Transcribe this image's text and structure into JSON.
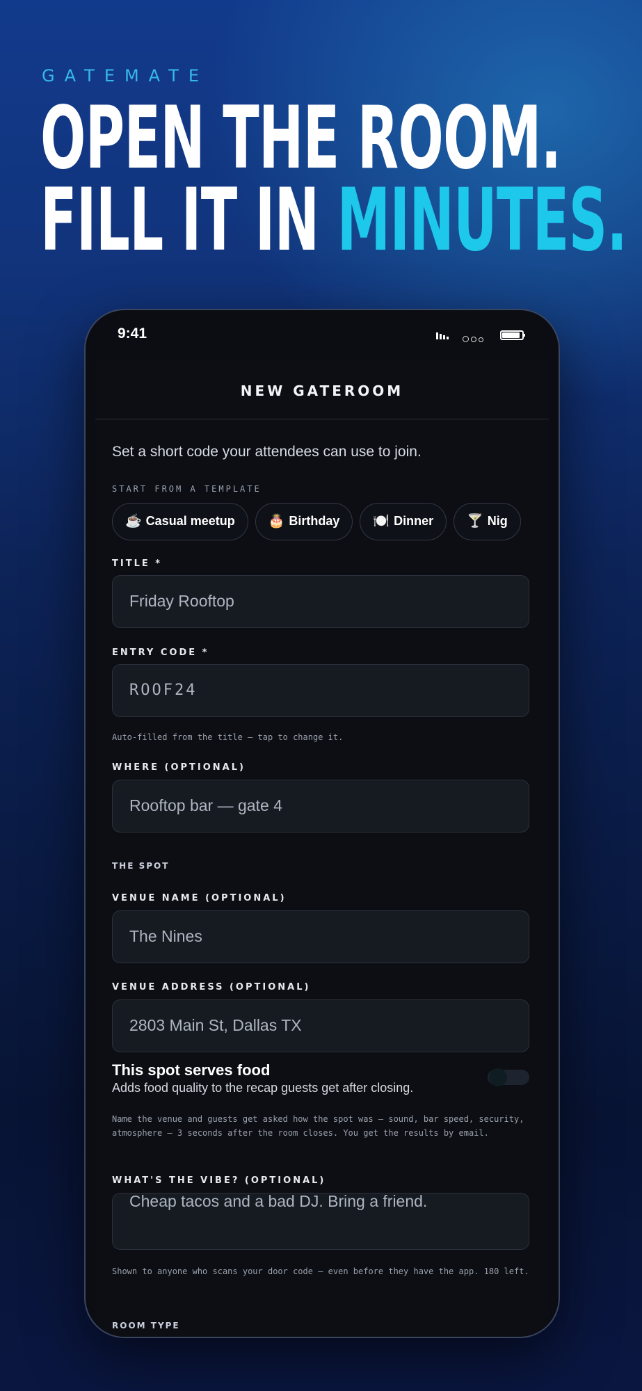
{
  "brand": "GATEMATE",
  "headline": {
    "line1": "OPEN THE ROOM.",
    "line2_prefix": "FILL IT IN ",
    "line2_accent": "MINUTES."
  },
  "status_bar": {
    "time": "9:41"
  },
  "nav": {
    "title": "NEW GATEROOM"
  },
  "form": {
    "lead": "Set a short code your attendees can use to join.",
    "template_heading": "START FROM A TEMPLATE",
    "templates": [
      {
        "icon": "☕",
        "label": "Casual meetup"
      },
      {
        "icon": "🎂",
        "label": "Birthday"
      },
      {
        "icon": "🍽️",
        "label": "Dinner"
      },
      {
        "icon": "🍸",
        "label": "Nig"
      }
    ],
    "title": {
      "label": "TITLE *",
      "value": "Friday Rooftop"
    },
    "entry_code": {
      "label": "ENTRY CODE *",
      "value": "ROOF24",
      "hint": "Auto-filled from the title — tap to change it."
    },
    "where": {
      "label": "WHERE (OPTIONAL)",
      "value": "Rooftop bar — gate 4"
    },
    "spot_heading": "THE SPOT",
    "venue_name": {
      "label": "VENUE NAME (OPTIONAL)",
      "value": "The Nines"
    },
    "venue_address": {
      "label": "VENUE ADDRESS (OPTIONAL)",
      "value": "2803 Main St, Dallas TX"
    },
    "food_toggle": {
      "title": "This spot serves food",
      "subtitle": "Adds food quality to the recap guests get after closing.",
      "on": false
    },
    "venue_hint": "Name the venue and guests get asked how the spot was — sound, bar speed, security, atmosphere — 3 seconds after the room closes. You get the results by email.",
    "vibe": {
      "label": "WHAT'S THE VIBE? (OPTIONAL)",
      "value": "Cheap tacos and a bad DJ. Bring a friend.",
      "hint": "Shown to anyone who scans your door code — even before they have the app. 180 left."
    },
    "room_type_heading": "ROOM TYPE"
  }
}
